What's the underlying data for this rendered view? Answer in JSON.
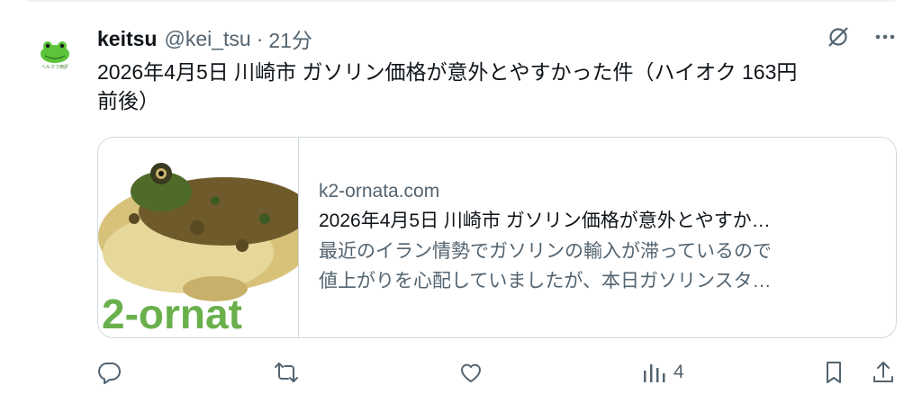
{
  "post": {
    "display_name": "keitsu",
    "handle": "@kei_tsu",
    "separator": "·",
    "time": "21分",
    "text_line1": "2026年4月5日 川崎市 ガソリン価格が意外とやすかった件（ハイオク 163円",
    "text_line2": "前後）"
  },
  "avatar": {
    "caption": "ヘルマフ用語"
  },
  "card": {
    "thumbnail_text": "2-ornat",
    "domain": "k2-ornata.com",
    "title": "2026年4月5日 川崎市 ガソリン価格が意外とやすか…",
    "desc_line1": "最近のイラン情勢でガソリンの輸入が滞っているので",
    "desc_line2": "値上がりを心配していましたが、本日ガソリンスタ…"
  },
  "actions": {
    "views_count": "4"
  },
  "icons": {
    "grok": "grok-icon",
    "more": "more-icon",
    "reply": "reply-icon",
    "repost": "repost-icon",
    "like": "like-icon",
    "views": "views-icon",
    "bookmark": "bookmark-icon",
    "share": "share-icon"
  },
  "colors": {
    "text": "#0f1419",
    "secondary": "#536471",
    "border": "#cfd9de",
    "thumb_text": "#6ab04c"
  }
}
